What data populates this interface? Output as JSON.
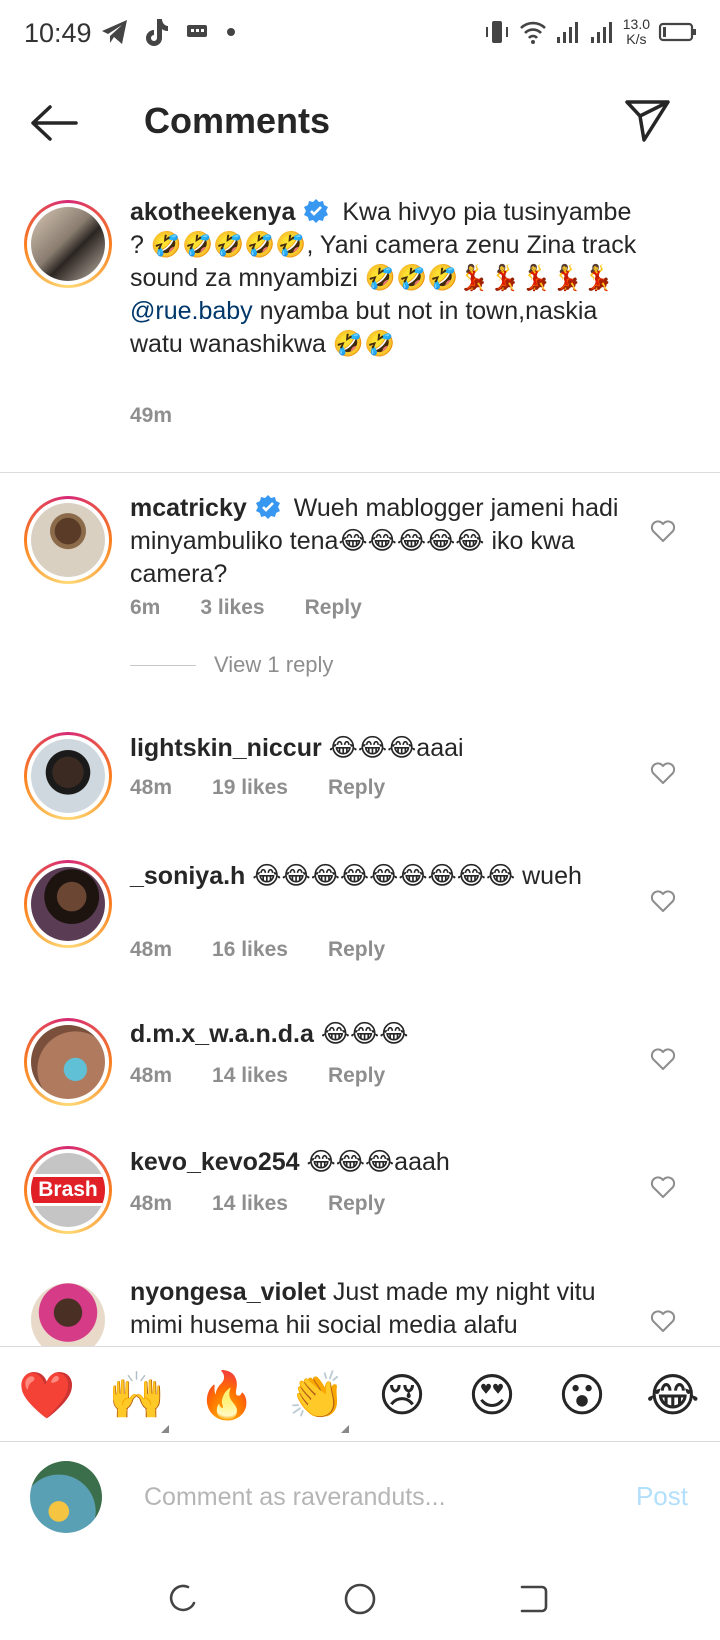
{
  "status_bar": {
    "time": "10:49",
    "net_speed_value": "13.0",
    "net_speed_unit": "K/s",
    "left_icons": [
      "telegram-icon",
      "tiktok-icon",
      "message-icon",
      "dot-icon"
    ],
    "right_icons": [
      "vibrate-icon",
      "wifi-icon",
      "signal-icon",
      "signal-icon",
      "battery-icon"
    ]
  },
  "header": {
    "title": "Comments",
    "back_icon": "arrow-left-icon",
    "share_icon": "paper-plane-icon"
  },
  "comments": [
    {
      "username": "akotheekenya",
      "verified": true,
      "text_part1": "Kwa hivyo pia tusinyambe ? 🤣🤣🤣🤣🤣, Yani camera zenu Zina track sound za mnyambizi 🤣🤣🤣💃💃💃💃💃",
      "mention": "@rue.baby",
      "text_part2": "nyamba but not in town,naskia watu wanashikwa 🤣🤣",
      "time": "49m"
    },
    {
      "username": "mcatricky",
      "verified": true,
      "text": "Wueh mablogger jameni hadi minyambuliko tena😂😂😂😂😂 iko kwa camera?",
      "time": "6m",
      "likes": "3 likes",
      "reply": "Reply",
      "view_replies": "View 1 reply"
    },
    {
      "username": "lightskin_niccur",
      "text": "😂😂😂aaai",
      "time": "48m",
      "likes": "19 likes",
      "reply": "Reply"
    },
    {
      "username": "_soniya.h",
      "text": "😂😂😂😂😂😂😂😂😂 wueh",
      "time": "48m",
      "likes": "16 likes",
      "reply": "Reply"
    },
    {
      "username": "d.m.x_w.a.n.d.a",
      "text": "😂😂😂",
      "time": "48m",
      "likes": "14 likes",
      "reply": "Reply"
    },
    {
      "username": "kevo_kevo254",
      "avatar_text": "Brash",
      "text": "😂😂😂aaah",
      "time": "48m",
      "likes": "14 likes",
      "reply": "Reply"
    },
    {
      "username": "nyongesa_violet",
      "text": "Just made my night vitu mimi husema hii social media alafu"
    }
  ],
  "reactions": [
    "❤️",
    "🙌",
    "🔥",
    "👏",
    "😢",
    "😍",
    "😮",
    "😂"
  ],
  "composer": {
    "placeholder": "Comment as raveranduts...",
    "post_label": "Post"
  },
  "nav": [
    "recents-icon",
    "home-icon",
    "back-icon"
  ]
}
